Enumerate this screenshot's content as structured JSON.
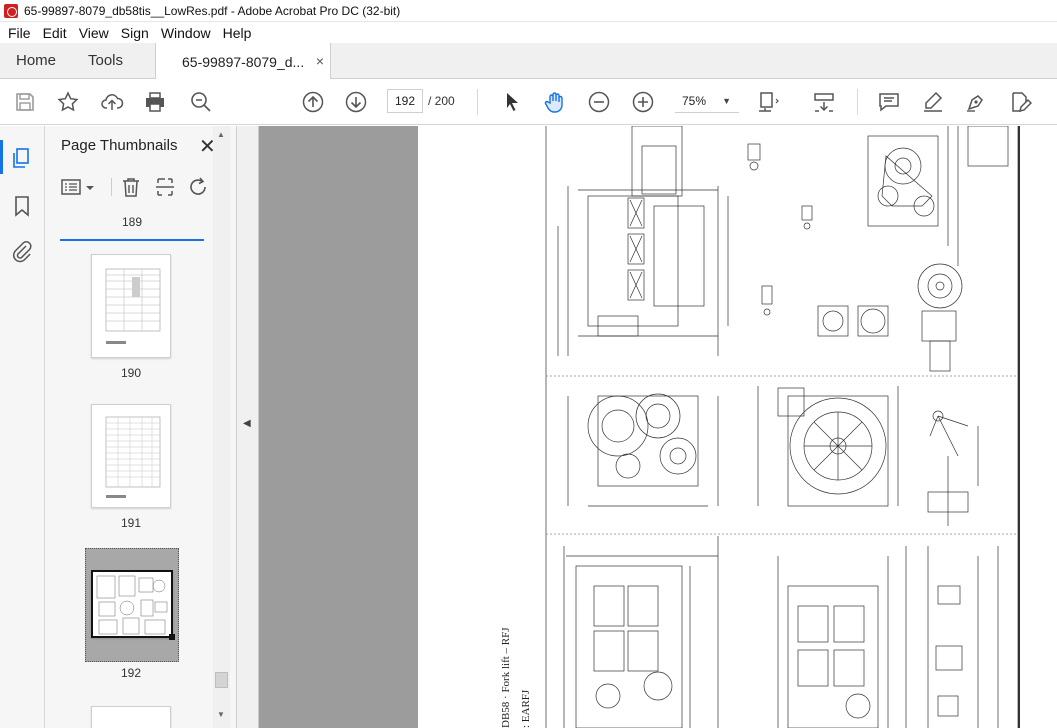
{
  "window": {
    "title": "65-99897-8079_db58tis__LowRes.pdf - Adobe Acrobat Pro DC (32-bit)"
  },
  "menu": [
    "File",
    "Edit",
    "View",
    "Sign",
    "Window",
    "Help"
  ],
  "tabs": {
    "home": "Home",
    "tools": "Tools",
    "document": "65-99897-8079_d...",
    "document_close": "×"
  },
  "toolbar": {
    "current_page": "192",
    "page_total": "/ 200",
    "zoom": "75%",
    "icons": [
      "save-icon",
      "bookmark-star-icon",
      "upload-icon",
      "print-icon",
      "zoom-search-icon",
      "page-up-icon",
      "page-down-icon",
      "select-arrow-icon",
      "hand-tool-icon",
      "zoom-out-icon",
      "zoom-in-icon",
      "fit-page-icon",
      "scroll-mode-icon",
      "comment-icon",
      "highlight-icon",
      "sign-icon",
      "edit-pdf-icon"
    ]
  },
  "left_rail": {
    "icons": [
      "page-thumbnails-icon",
      "bookmarks-icon",
      "attachments-icon"
    ]
  },
  "thumbnails_panel": {
    "title": "Page Thumbnails",
    "close": "✕",
    "tools": [
      "options-menu-icon",
      "delete-page-icon",
      "extract-page-icon",
      "rotate-page-icon"
    ],
    "pages": [
      {
        "label": "189"
      },
      {
        "label": "190"
      },
      {
        "label": "191"
      },
      {
        "label": "192",
        "selected": true
      }
    ]
  },
  "document": {
    "visible_text": [
      "DB58 · Fork lift – RFJ",
      ": EARFJ"
    ]
  },
  "colors": {
    "accent": "#1473e6",
    "doc_bg": "#9c9c9c",
    "panel_bg": "#f6f6f6"
  }
}
